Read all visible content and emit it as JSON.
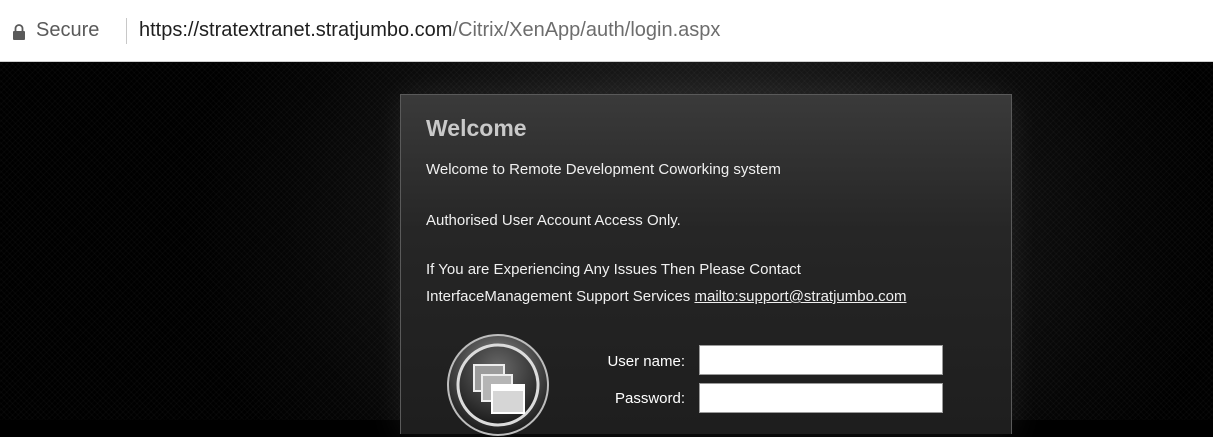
{
  "browser": {
    "secure_label": "Secure",
    "url_scheme_host": "https://stratextranet.stratjumbo.com",
    "url_path": "/Citrix/XenApp/auth/login.aspx"
  },
  "login": {
    "title": "Welcome",
    "line1": "Welcome to Remote Development Coworking system",
    "line2": "Authorised User Account Access Only.",
    "line3": "If You are Experiencing Any Issues Then Please Contact",
    "line4_prefix": "InterfaceManagement Support Services ",
    "support_link": "mailto:support@stratjumbo.com",
    "username_label": "User name:",
    "username_value": "",
    "password_label": "Password:",
    "password_value": ""
  },
  "icons": {
    "lock": "lock-icon",
    "logo": "citrix-windows-logo-icon"
  }
}
